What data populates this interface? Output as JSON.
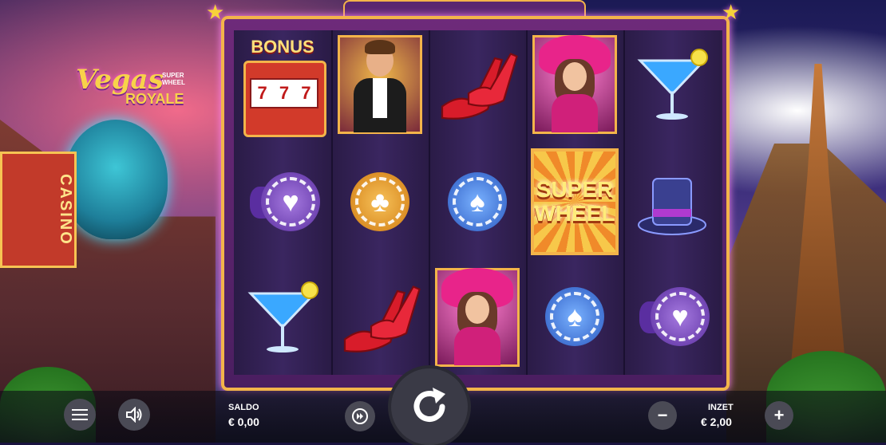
{
  "game": {
    "logo_line1": "Vegas",
    "logo_line2": "ROYALE",
    "logo_badge": "SUPER WHEEL",
    "casino_sign": "CASINO"
  },
  "reels": {
    "symbols": {
      "bonus_label": "BONUS",
      "slot_digits": [
        "7",
        "7",
        "7"
      ],
      "super_wheel_line1": "SUPER",
      "super_wheel_line2": "WHEEL"
    }
  },
  "controls": {
    "balance_label": "SALDO",
    "balance_value": "€ 0,00",
    "bet_label": "INZET",
    "bet_value": "€ 2,00",
    "minus": "−",
    "plus": "+"
  },
  "colors": {
    "frame_gold": "#f3b44a",
    "frame_purple": "#6e2a7a",
    "control_bar": "#0a0a14"
  }
}
